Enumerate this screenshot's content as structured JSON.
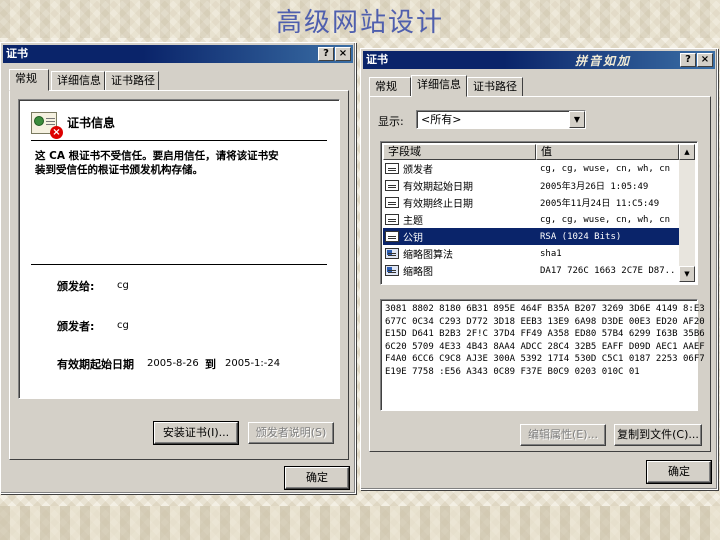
{
  "slide": {
    "title": "高级网站设计"
  },
  "left_dialog": {
    "title": "证书",
    "help_btn": "?",
    "close_btn": "×",
    "tabs": [
      "常规",
      "详细信息",
      "证书路径"
    ],
    "info_heading": "证书信息",
    "warning_line1": "这 CA 根证书不受信任。要启用信任，请将该证书安",
    "warning_line2": "装到受信任的根证书颁发机构存储。",
    "issued_to_label": "颁发给:",
    "issued_to_value": "cg",
    "issued_by_label": "颁发者:",
    "issued_by_value": "cg",
    "validity_label": "有效期起始日期",
    "validity_from": "2005-8-26",
    "validity_to_label": "到",
    "validity_to": "2005-1:-24",
    "install_btn": "安装证书(I)...",
    "issuer_stmt_btn": "颁发者说明(S)",
    "ok_btn": "确定"
  },
  "right_dialog": {
    "title": "证书",
    "decor": "拼音如加",
    "help_btn": "?",
    "close_btn": "×",
    "tabs": [
      "常规",
      "详细信息",
      "证书路径"
    ],
    "show_label": "显示:",
    "show_value": "<所有>",
    "col_field": "字段域",
    "col_value": "值",
    "rows": [
      {
        "field": "颁发者",
        "value": "cg, cg, wuse, cn, wh, cn",
        "icon": "field-icon"
      },
      {
        "field": "有效期起始日期",
        "value": "2005年3月26日 1:05:49",
        "icon": "field-icon"
      },
      {
        "field": "有效期终止日期",
        "value": "2005年11月24日 11:C5:49",
        "icon": "field-icon"
      },
      {
        "field": "主题",
        "value": "cg, cg, wuse, cn, wh, cn",
        "icon": "field-icon"
      },
      {
        "field": "公钥",
        "value": "RSA (1024 Bits)",
        "icon": "field-icon",
        "selected": true
      },
      {
        "field": "缩略图算法",
        "value": "sha1",
        "icon": "extension-icon"
      },
      {
        "field": "缩略图",
        "value": "DA17 726C 1663 2C7E D87..",
        "icon": "extension-icon"
      }
    ],
    "hex_lines": [
      "3081 8802 8180 6B31 895E 464F B35A B207 3269 3D6E 4149 8:E3",
      "677C 0C34 C293 D772 3D18 EEB3 13E9 6A98 D3DE 00E3 ED20 AF20",
      "E15D D641 B2B3 2F!C 37D4 FF49 A358 ED80 57B4 6299 I63B 35B6",
      "6C20 5709 4E33 4B43 8AA4 ADCC 28C4 32B5 EAFF D09D AEC1 AAEF",
      "F4A0 6CC6 C9C8 AJ3E 300A 5392 17I4 530D C5C1 0187 2253 06F7",
      "E19E 7758 :E56 A343 0C89 F37E B0C9 0203 010C 01"
    ],
    "edit_props_btn": "编辑属性(E)...",
    "copy_file_btn": "复制到文件(C)...",
    "ok_btn": "确定"
  }
}
